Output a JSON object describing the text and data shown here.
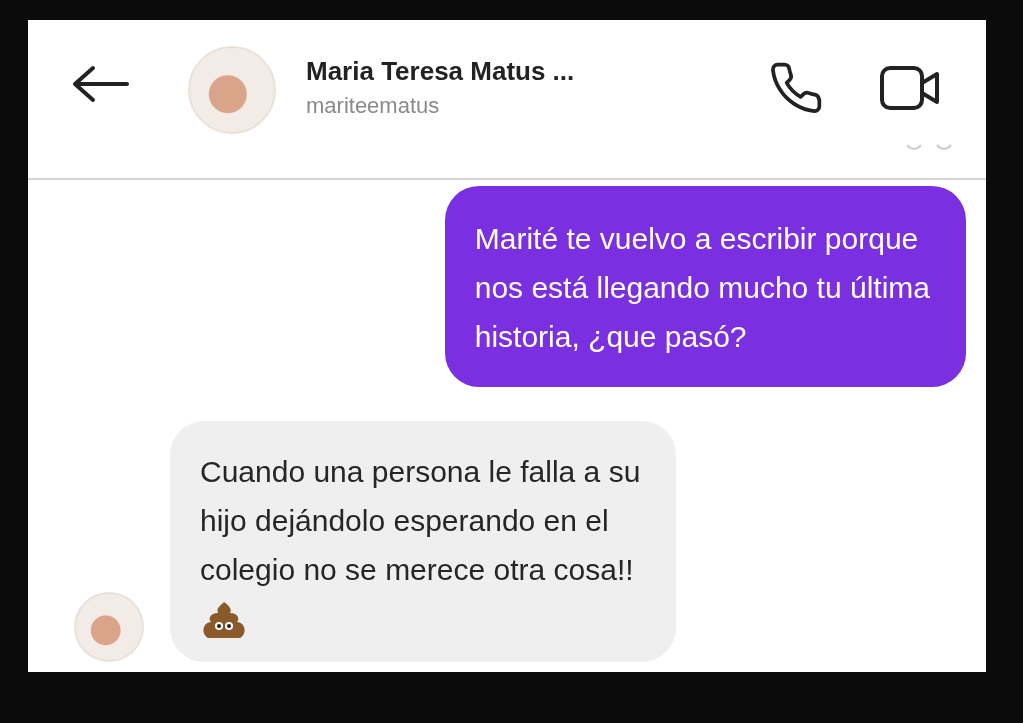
{
  "header": {
    "name": "Maria Teresa Matus ...",
    "username": "mariteematus"
  },
  "messages": [
    {
      "kind": "sent",
      "lines": [
        "Marité te vuelvo a escribir porque",
        "nos está llegando mucho tu última",
        "historia, ¿que pasó?"
      ],
      "emoji": false
    },
    {
      "kind": "received",
      "lines": [
        "Cuando una persona le falla a su",
        "hijo dejándolo esperando en el",
        "colegio no se merece otra cosa!!"
      ],
      "emoji": true
    }
  ]
}
